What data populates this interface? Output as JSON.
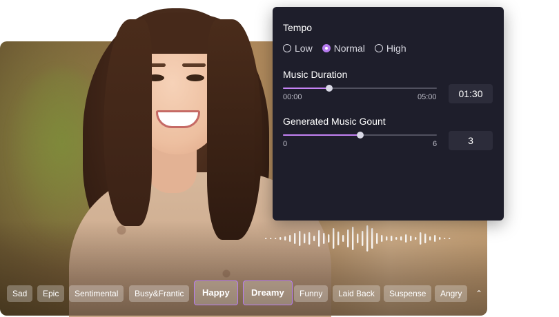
{
  "settings": {
    "tempo": {
      "title": "Tempo",
      "options": [
        {
          "label": "Low",
          "selected": false
        },
        {
          "label": "Normal",
          "selected": true
        },
        {
          "label": "High",
          "selected": false
        }
      ]
    },
    "duration": {
      "title": "Music Duration",
      "min_label": "00:00",
      "max_label": "05:00",
      "value": "01:30",
      "level": 0.3
    },
    "count": {
      "title": "Generated Music Gount",
      "min_label": "0",
      "max_label": "6",
      "value": "3",
      "level": 0.5
    }
  },
  "moods": [
    {
      "label": "Sad",
      "selected": false
    },
    {
      "label": "Epic",
      "selected": false
    },
    {
      "label": "Sentimental",
      "selected": false
    },
    {
      "label": "Busy&Frantic",
      "selected": false
    },
    {
      "label": "Happy",
      "selected": true
    },
    {
      "label": "Dreamy",
      "selected": true
    },
    {
      "label": "Funny",
      "selected": false
    },
    {
      "label": "Laid Back",
      "selected": false
    },
    {
      "label": "Suspense",
      "selected": false
    },
    {
      "label": "Angry",
      "selected": false
    }
  ],
  "collapse_icon": "double-chevron-up-icon",
  "colors": {
    "accent": "#b77cf0",
    "panel_bg": "#1e1e2b",
    "slider_fill": "#c583f5"
  }
}
